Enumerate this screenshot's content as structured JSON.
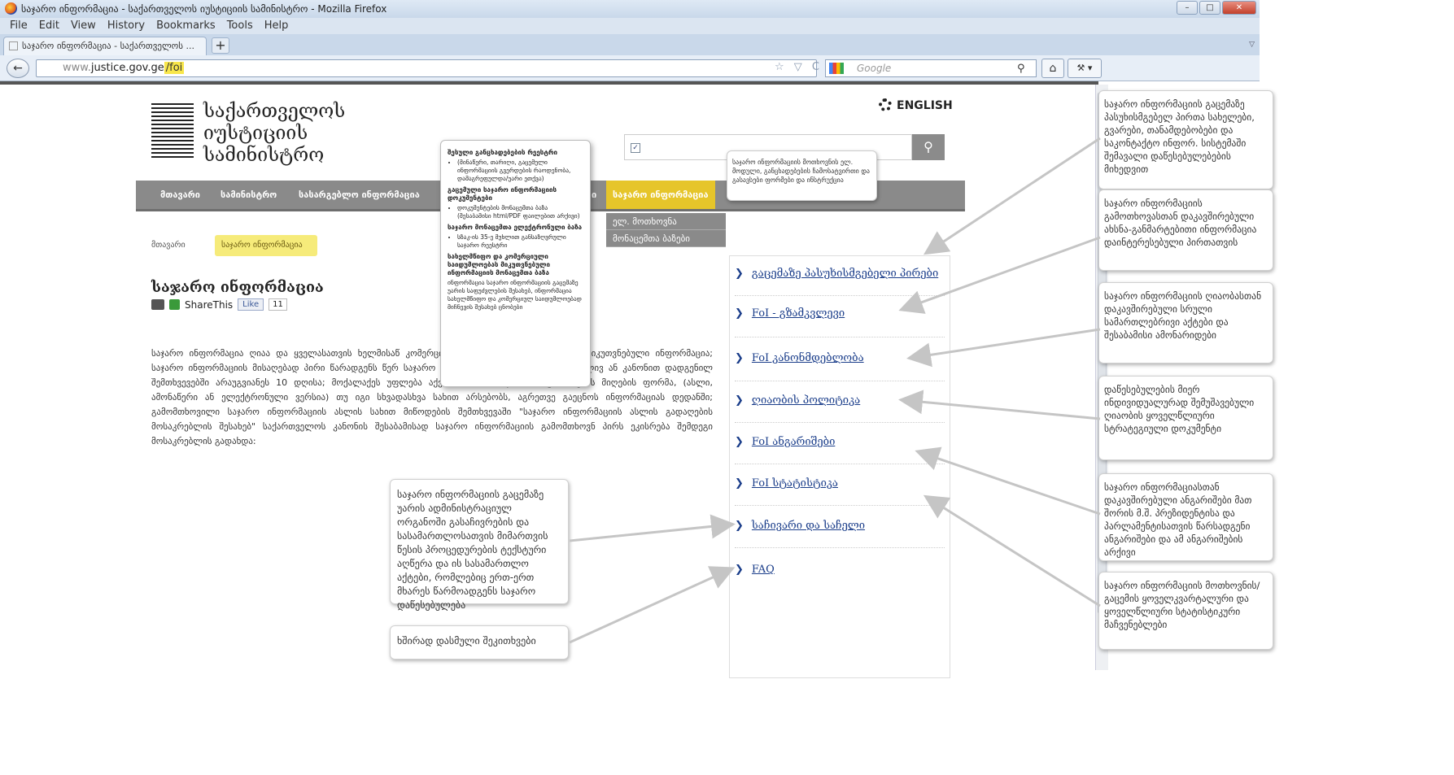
{
  "browser": {
    "window_title": "საჯარო ინფორმაცია - საქართველოს იუსტიციის სამინისტრო - Mozilla Firefox",
    "menu": [
      "File",
      "Edit",
      "View",
      "History",
      "Bookmarks",
      "Tools",
      "Help"
    ],
    "tab_title": "საჯარო ინფორმაცია - საქართველოს ...",
    "url_prefix": "www.",
    "url_domain": "justice.gov.ge",
    "url_path": "/foi",
    "search_placeholder": "Google"
  },
  "site": {
    "name_lines": [
      "საქართველოს",
      "იუსტიციის",
      "სამინისტრო"
    ],
    "language_link": "ENGLISH",
    "nav": [
      "მთავარი",
      "სამინისტრო",
      "სასარგებლო ინფორმაცია",
      "ი",
      "საჯარო ინფორმაცია"
    ],
    "dropdown": [
      "ელ. მოთხოვნა",
      "მონაცემთა ბაზები"
    ],
    "nav_tooltip": "საჯარო ინფორმაციის მოთხოვნის ელ. მოდული, განცხადებების ჩამოსატვირთი და გასავსები ფორმები და ინსტრუქცია",
    "breadcrumb": [
      "მთავარი",
      "საჯარო ინფორმაცია"
    ],
    "page_title": "საჯარო ინფორმაცია",
    "share": {
      "sharethis": "ShareThis",
      "like": "Like",
      "count": "11"
    },
    "body_text": "საჯარო ინფორმაცია ღიაა და ყველასათვის ხელმისაწ კომერციულ და პირად საიდუმლოებას მიკუთვნებული ინფორმაცია; საჯარო ინფორმაციის მისაღებად პირი წარადგენს წერ საჯარო ინფორმაცია გაიცემა დაუყოვნებლივ ან კანონით დადგენილ შემთხვევებში არაუგვიანეს 10 დღისა; მოქალაქეს უფლება აქვს აირჩიოს საჯარო ინფორმაციის მიღების ფორმა, (ასლი, ამონაწერი ან ელექტრონული ვერსია) თუ იგი სხვადასხვა სახით არსებობს, აგრეთვე გაეცნოს ინფორმაციას დედანში; გამომთხოვილი საჯარო ინფორმაციის ასლის სახით მიწოდების შემთხვევაში \"საჯარო ინფორმაციის ასლის გადაღების მოსაკრებლის შესახებ\" საქართველოს კანონის შესაბამისად საჯარო ინფორმაციის გამომთხოვნ პირს ეკისრება შემდეგი მოსაკრებლის გადახდა:",
    "popup": [
      {
        "title": "შესული განცხადებების რეესტრი",
        "items": [
          "(მინაწერი, თარიღი, გაცემული ინფორმაციის გვერდების რაოდენობა, დამაგრეფულდა/უარი ეთქვა)"
        ]
      },
      {
        "title": "გაცემული საჯარო ინფორმაციის დოკუმენტები",
        "items": [
          "დოკუმენტების მონაცემთა ბაზა (შესაბამისი html/PDF ფაილებით არქივი)"
        ]
      },
      {
        "title": "საჯარო მონაცემთა ელექტრონული ბაზა",
        "items": [
          "სზაკ-ის 35-ე მუხლით განსაზღვრული საჯარო რეესტრი"
        ]
      },
      {
        "title": "სახელმწიფო და კომერციული საიდუმლოებას მიკუთვნებული ინფორმაციის მონაცემთა ბაზა",
        "items": [
          "ინფორმაცია საჯარო ინფორმაციის გაცემაზე უარის საფუძვლების შესახებ, ინფორმაცია სახელმწიფო და კომერციულ საიდუმლოებად მიჩნევის შესახებ ცნობები"
        ]
      }
    ],
    "sidebar": [
      "გაცემაზე პასუხისმგებელი პირები",
      "FoI - გზამკვლევი",
      "FoI კანონმდებლობა",
      "ღიაობის პოლიტიკა",
      "FoI ანგარიშები",
      "FoI სტატისტიკა",
      "საჩივარი და საჩელი",
      "FAQ"
    ]
  },
  "annotations": {
    "left_note_1": "საჯარო ინფორმაციის გაცემაზე უარის ადმინისტრაციულ ორგანოში გასაჩივრების და სასამართლოსათვის მიმართვის წესის პროცედურების ტექსტური აღწერა და ის სასამართლო აქტები, რომლებიც ერთ-ერთ მხარეს წარმოადგენს საჯარო დაწესებულება",
    "left_note_2": "ხშირად დასმული შეკითხვები",
    "right_notes": [
      "საჯარო ინფორმაციის გაცემაზე პასუხისმგებელ პირთა სახელები, გვარები, თანამდებობები და საკონტაქტო ინფორ. სისტემაში შემავალი დაწესებულებების მიხედვით",
      "საჯარო ინფორმაციის გამოთხოვასთან დაკავშირებული ახსნა-განმარტებითი ინფორმაცია დაინტერესებული პირთათვის",
      "საჯარო ინფორმაციის ღიაობასთან დაკავშირებული სრული სამართლებრივი აქტები და შესაბამისი ამონარიდები",
      "დაწესებულების მიერ ინდივიდუალურად შემუშავებული ღიაობის ყოველწლიური სტრატეგიული დოკუმენტი",
      "საჯარო ინფორმაციასთან დაკავშირებული ანგარიშები მათ შორის მ.შ. პრეზიდენტისა და პარლამენტისათვის წარსადგენი ანგარიშები და ამ ანგარიშების არქივი",
      "საჯარო ინფორმაციის მოთხოვნის/გაცემის ყოველკვარტალური და ყოველწლიური სტატისტიკური მაჩვენებლები"
    ]
  },
  "colors": {
    "nav_bg": "#8a8a8a",
    "nav_active": "#e6c52a",
    "link": "#1a3d8a",
    "highlight": "#f8e64a"
  }
}
